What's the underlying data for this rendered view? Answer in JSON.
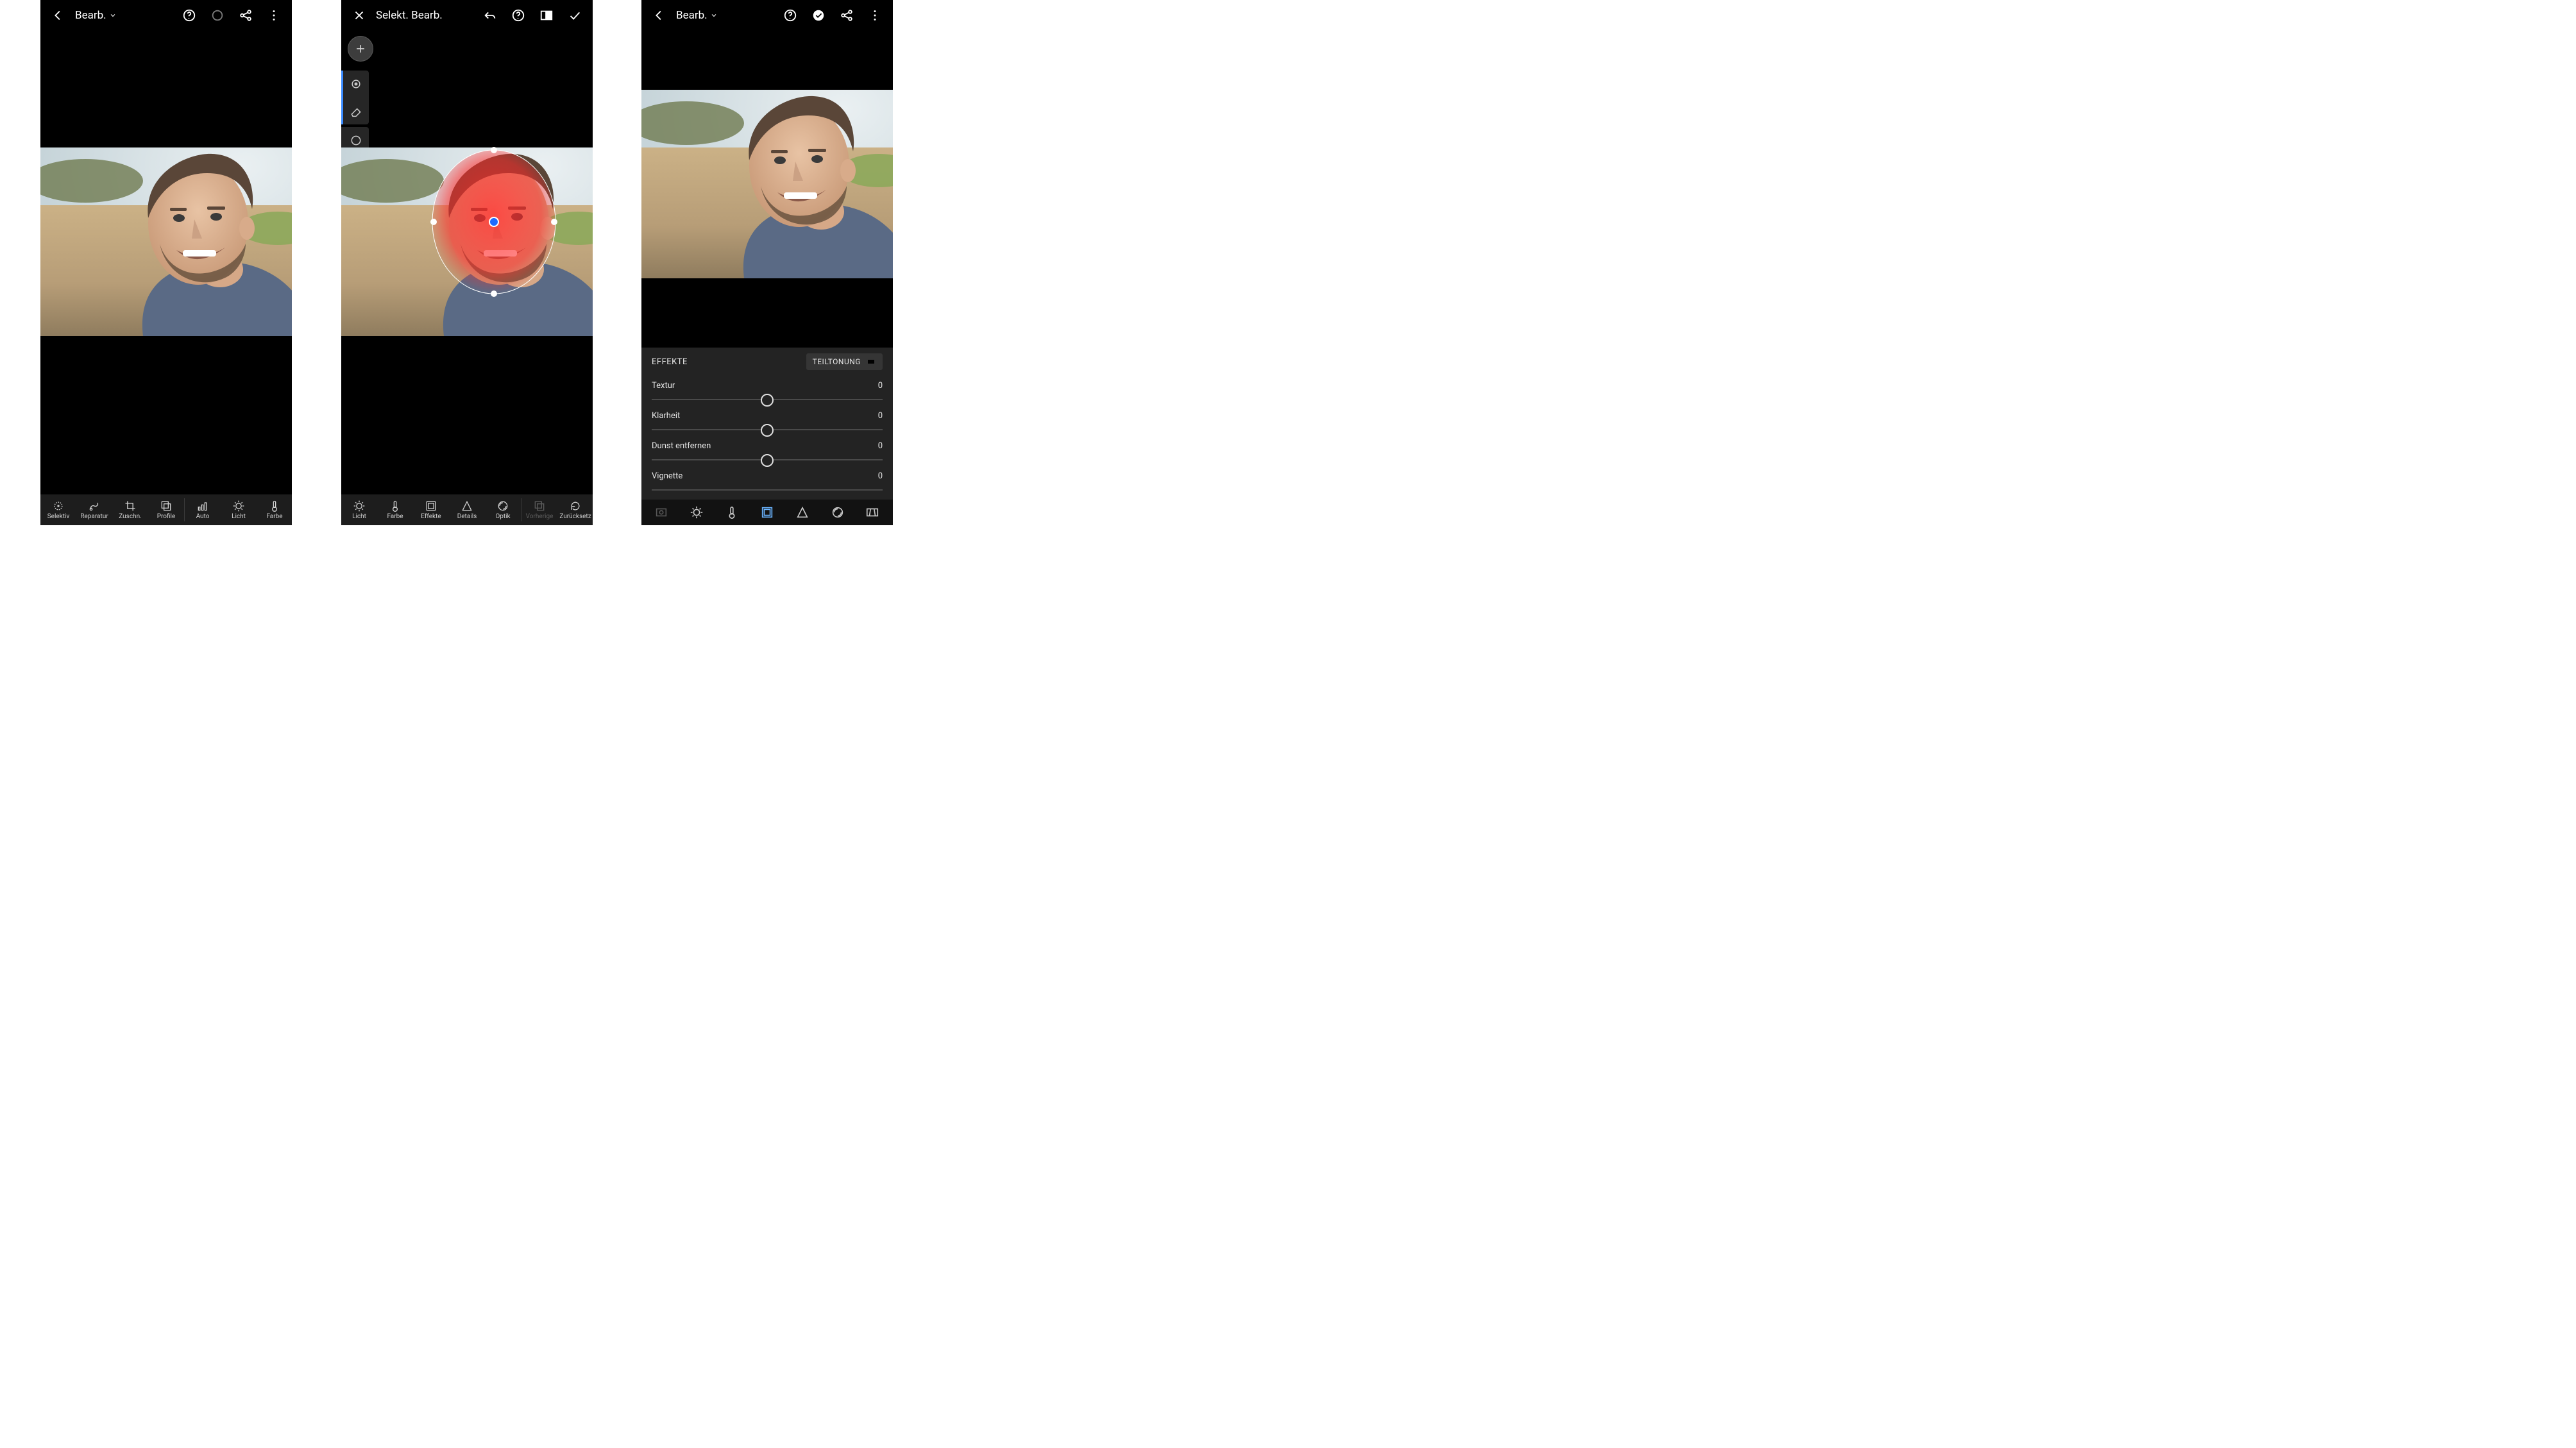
{
  "screen1": {
    "title": "Bearb.",
    "tools": [
      {
        "id": "selective",
        "label": "Selektiv"
      },
      {
        "id": "repair",
        "label": "Reparatur"
      },
      {
        "id": "crop",
        "label": "Zuschn."
      },
      {
        "id": "profiles",
        "label": "Profile"
      },
      {
        "id": "auto",
        "label": "Auto"
      },
      {
        "id": "light",
        "label": "Licht"
      },
      {
        "id": "color",
        "label": "Farbe"
      }
    ]
  },
  "screen2": {
    "title": "Selekt. Bearb.",
    "tools": [
      {
        "id": "light",
        "label": "Licht"
      },
      {
        "id": "color",
        "label": "Farbe"
      },
      {
        "id": "effects",
        "label": "Effekte"
      },
      {
        "id": "details",
        "label": "Details"
      },
      {
        "id": "optics",
        "label": "Optik"
      },
      {
        "id": "previous",
        "label": "Vorherige",
        "disabled": true
      },
      {
        "id": "reset",
        "label": "Zurücksetz"
      }
    ]
  },
  "screen3": {
    "title": "Bearb.",
    "panel_title": "EFFEKTE",
    "split_label": "TEILTONUNG",
    "sliders": [
      {
        "id": "texture",
        "label": "Textur",
        "value": "0"
      },
      {
        "id": "clarity",
        "label": "Klarheit",
        "value": "0"
      },
      {
        "id": "dehaze",
        "label": "Dunst entfernen",
        "value": "0"
      },
      {
        "id": "vignette",
        "label": "Vignette",
        "value": "0"
      }
    ]
  },
  "icons": {
    "help": "?",
    "more": "⋮",
    "share": "share",
    "back": "←",
    "close": "×",
    "undo": "↶",
    "check": "✓",
    "compare": "⧉",
    "plus": "+"
  }
}
